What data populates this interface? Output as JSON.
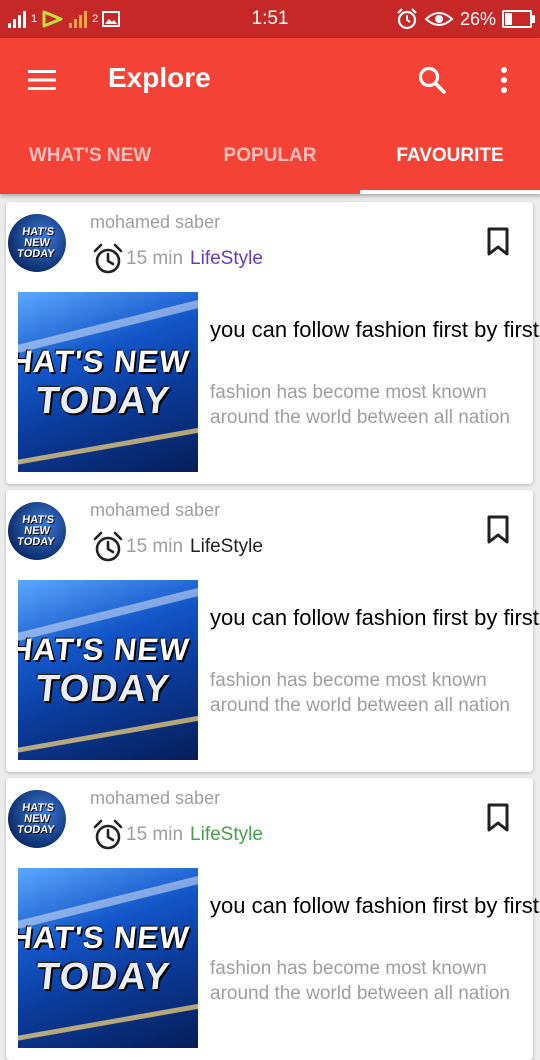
{
  "status_bar": {
    "time": "1:51",
    "battery_percent": "26%",
    "battery_level": 0.26,
    "sim1_number": "1",
    "sim2_number": "2"
  },
  "app_bar": {
    "title": "Explore",
    "icons": {
      "menu": "menu-icon",
      "search": "search-icon",
      "more": "more-vert-icon"
    },
    "color": "#f44336"
  },
  "tabs": [
    {
      "label": "WHAT'S NEW",
      "active": false
    },
    {
      "label": "POPULAR",
      "active": false
    },
    {
      "label": "FAVOURITE",
      "active": true
    }
  ],
  "articles": [
    {
      "author": "mohamed saber",
      "duration": "15 min",
      "category": "LifeStyle",
      "category_color": "#673ab7",
      "headline": "you can follow fashion first by first",
      "summary": "fashion has become most known around the world between all nation",
      "avatar_text": "HAT'S NEW TODAY",
      "thumbnail_text_1": "HAT'S NEW",
      "thumbnail_text_2": "TODAY"
    },
    {
      "author": "mohamed saber",
      "duration": "15 min",
      "category": "LifeStyle",
      "category_color": "#212121",
      "headline": "you can follow fashion first by first",
      "summary": "fashion has become most known around the world between all nation",
      "avatar_text": "HAT'S NEW TODAY",
      "thumbnail_text_1": "HAT'S NEW",
      "thumbnail_text_2": "TODAY"
    },
    {
      "author": "mohamed saber",
      "duration": "15 min",
      "category": "LifeStyle",
      "category_color": "#43a047",
      "headline": "you can follow fashion first by first",
      "summary": "fashion has become most known around the world between all nation",
      "avatar_text": "HAT'S NEW TODAY",
      "thumbnail_text_1": "HAT'S NEW",
      "thumbnail_text_2": "TODAY"
    }
  ]
}
